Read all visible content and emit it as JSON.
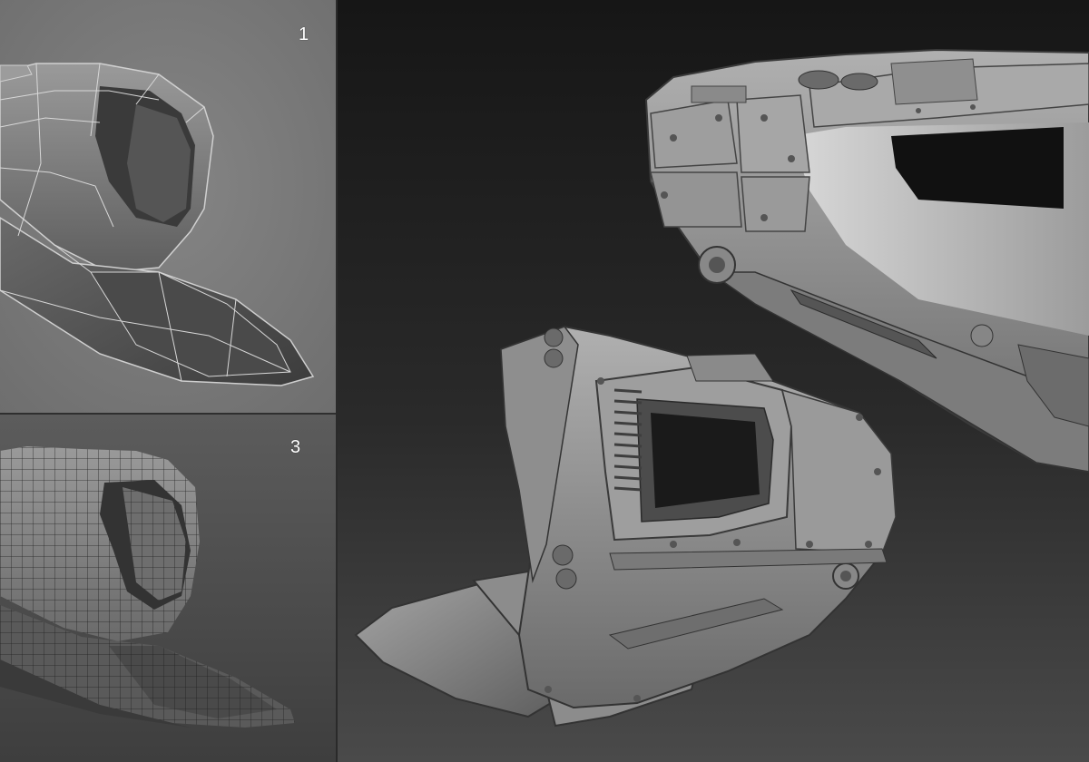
{
  "panels": [
    {
      "id": "blockout",
      "label": "1",
      "description_shown": false
    },
    {
      "id": "sculpt",
      "label": "",
      "description_shown": false
    },
    {
      "id": "retopology",
      "label": "3",
      "description_shown": false
    }
  ],
  "colors": {
    "panel_light_bg": "#808080",
    "panel_dark_bg": "#262626",
    "mesh_fill": "#7d7d7d",
    "wire_light": "#c8c8c8",
    "wire_dark": "#2a2a2a",
    "sculpt_fill": "#8a8a8a"
  }
}
